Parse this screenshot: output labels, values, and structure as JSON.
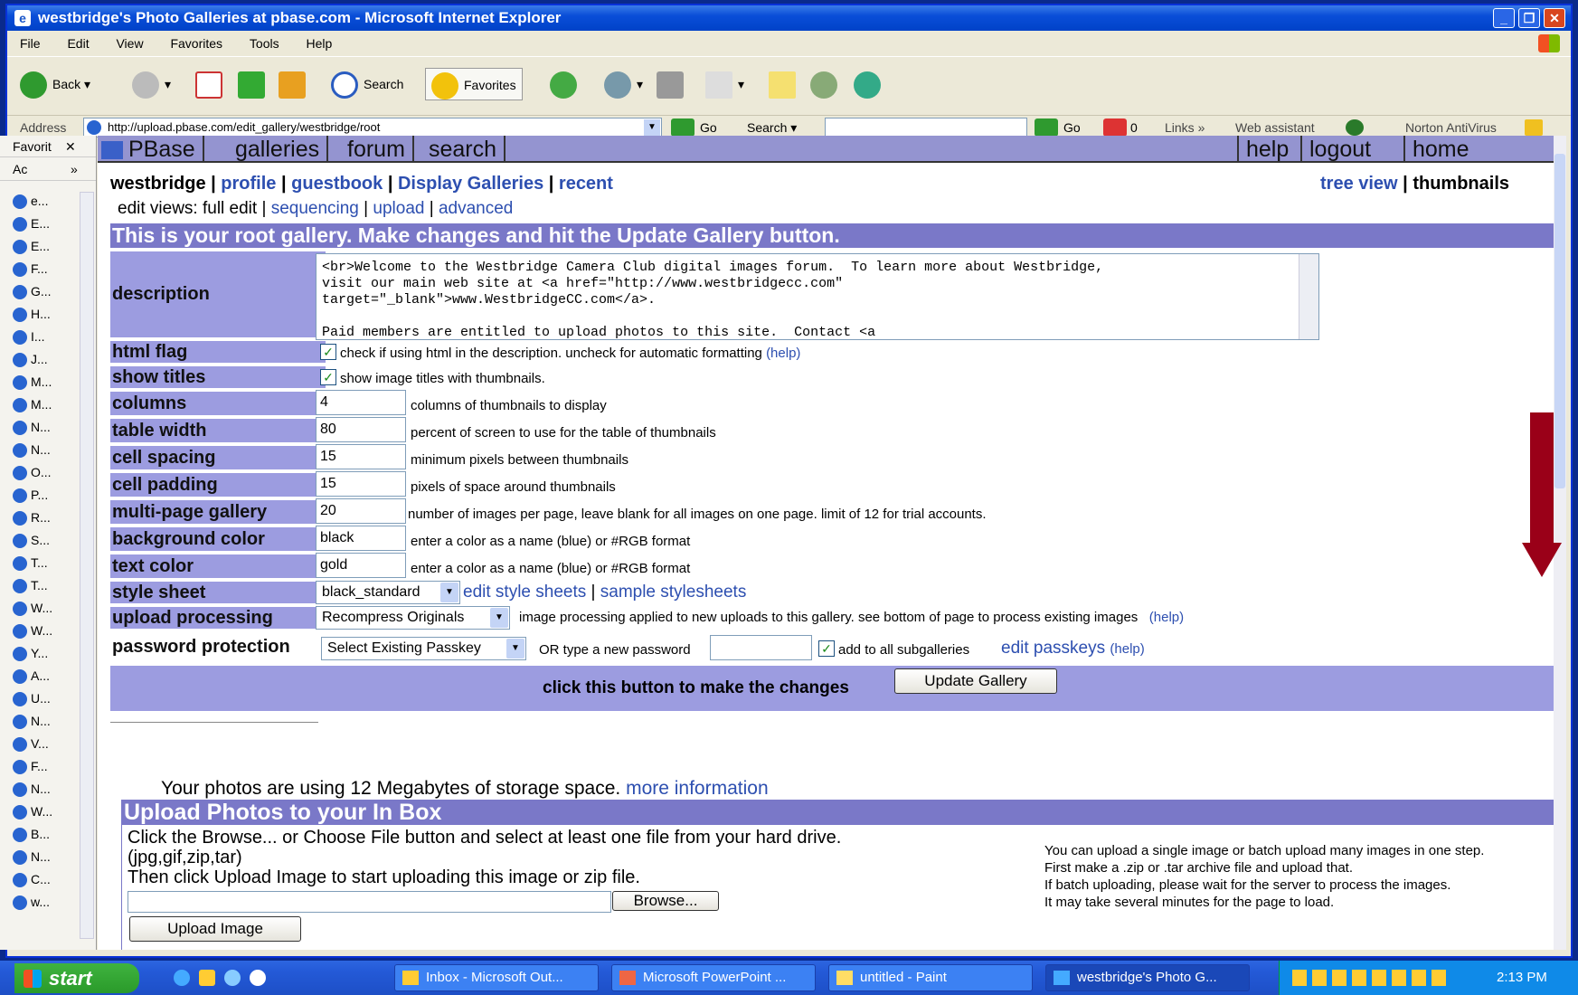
{
  "window": {
    "title": "westbridge's Photo Galleries at pbase.com - Microsoft Internet Explorer"
  },
  "menu": [
    "File",
    "Edit",
    "View",
    "Favorites",
    "Tools",
    "Help"
  ],
  "toolbar": {
    "back": "Back",
    "search": "Search",
    "favorites": "Favorites"
  },
  "address": {
    "label": "Address",
    "url": "http://upload.pbase.com/edit_gallery/westbridge/root",
    "go": "Go",
    "search": "Search",
    "go2": "Go",
    "count": "0",
    "links": "Links",
    "web_assistant": "Web assistant",
    "norton": "Norton AntiVirus"
  },
  "favorites": {
    "title": "Favorit",
    "ac": "Ac",
    "items": [
      "e...",
      "E...",
      "E...",
      "F...",
      "G...",
      "H...",
      "I...",
      "J...",
      "M...",
      "M...",
      "N...",
      "N...",
      "O...",
      "P...",
      "R...",
      "S...",
      "T...",
      "T...",
      "W...",
      "W...",
      "Y...",
      "A...",
      "U...",
      "N...",
      "V...",
      "F...",
      "N...",
      "W...",
      "B...",
      "N...",
      "C...",
      "w..."
    ]
  },
  "pbase_nav": {
    "logo": "PBase",
    "items": [
      "galleries",
      "forum",
      "search"
    ],
    "right": [
      "help",
      "logout",
      "home"
    ]
  },
  "user": {
    "name": "westbridge",
    "links": [
      "profile",
      "guestbook",
      "Display Galleries",
      "recent"
    ],
    "tree_view": "tree view",
    "thumbnails": "thumbnails"
  },
  "views": {
    "prefix": "edit views: full edit",
    "links": [
      "sequencing",
      "upload",
      "advanced"
    ]
  },
  "root_banner": "This is your root gallery. Make changes and hit the Update Gallery button.",
  "form": {
    "description": {
      "label": "description",
      "value": "<br>Welcome to the Westbridge Camera Club digital images forum.  To learn more about Westbridge,\nvisit our main web site at <a href=\"http://www.westbridgecc.com\"\ntarget=\"_blank\">www.WestbridgeCC.com</a>.\n\nPaid members are entitled to upload photos to this site.  Contact <a"
    },
    "html_flag": {
      "label": "html flag",
      "text": "check if using html in the description. uncheck for automatic formatting",
      "help": "(help)"
    },
    "show_titles": {
      "label": "show titles",
      "text": "show image titles with thumbnails."
    },
    "columns": {
      "label": "columns",
      "value": "4",
      "text": "columns of thumbnails to display"
    },
    "table_width": {
      "label": "table width",
      "value": "80",
      "text": "percent of screen to use for the table of thumbnails"
    },
    "cell_spacing": {
      "label": "cell spacing",
      "value": "15",
      "text": "minimum pixels between thumbnails"
    },
    "cell_padding": {
      "label": "cell padding",
      "value": "15",
      "text": "pixels of space around thumbnails"
    },
    "multi_page": {
      "label": "multi-page gallery",
      "value": "20",
      "text": "number of images per page, leave blank for all images on one page. limit of 12 for trial accounts."
    },
    "bg_color": {
      "label": "background color",
      "value": "black",
      "text": "enter a color as a name (blue) or #RGB format"
    },
    "text_color": {
      "label": "text color",
      "value": "gold",
      "text": "enter a color as a name (blue) or #RGB format"
    },
    "style_sheet": {
      "label": "style sheet",
      "value": "black_standard",
      "link1": "edit style sheets",
      "link2": "sample stylesheets"
    },
    "upload_processing": {
      "label": "upload processing",
      "value": "Recompress Originals",
      "text": "image processing applied to new uploads to this gallery. see bottom of page to process existing images",
      "help": "(help)"
    },
    "password": {
      "label": "password protection",
      "value": "Select Existing Passkey",
      "or_text": "OR  type a new password",
      "sub_text": "add to all subgalleries",
      "edit_link": "edit passkeys",
      "help": "(help)"
    },
    "update": {
      "text": "click this button to make the changes",
      "button": "Update Gallery"
    }
  },
  "storage": {
    "text": "Your photos are using 12 Megabytes of storage space.",
    "link": "more information"
  },
  "upload": {
    "title": "Upload Photos to your In Box",
    "line1": "Click the Browse... or Choose File button and select at least one file from your hard drive.",
    "line2": "(jpg,gif,zip,tar)",
    "line3": "Then click Upload Image to start uploading this image or zip file.",
    "browse": "Browse...",
    "button": "Upload Image",
    "right1": "You can upload a single image or batch upload many images in one step.",
    "right2": "First make a .zip or .tar archive file and upload that.",
    "right3": "If batch uploading, please wait for the server to process the images.",
    "right4": "It may take several minutes for the page to load."
  },
  "taskbar": {
    "start": "start",
    "tasks": [
      "Inbox - Microsoft Out...",
      "Microsoft PowerPoint ...",
      "untitled - Paint",
      "westbridge's Photo G..."
    ],
    "time": "2:13 PM"
  },
  "colors": {
    "title_blue": "#0a4ed8",
    "nav": "#9494d0",
    "label": "#9c9ce0",
    "banner": "#7a78c8",
    "link": "#2d4fb0",
    "arrow": "#9a0018"
  }
}
